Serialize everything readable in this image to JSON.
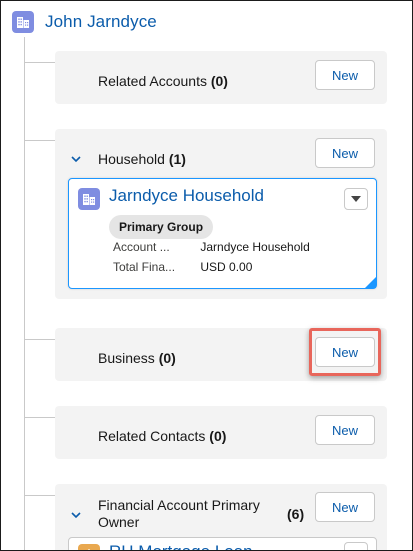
{
  "header": {
    "title": "John Jarndyce",
    "icon": "account-icon"
  },
  "groups": {
    "related_accounts": {
      "label": "Related Accounts",
      "count": "(0)",
      "new_label": "New"
    },
    "household": {
      "label": "Household",
      "count": "(1)",
      "new_label": "New",
      "record": {
        "title": "Jarndyce Household",
        "badge": "Primary Group",
        "fields": [
          {
            "label": "Account ...",
            "value": "Jarndyce Household"
          },
          {
            "label": "Total Fina...",
            "value": "USD 0.00"
          }
        ]
      }
    },
    "business": {
      "label": "Business",
      "count": "(0)",
      "new_label": "New"
    },
    "related_contacts": {
      "label": "Related Contacts",
      "count": "(0)",
      "new_label": "New"
    },
    "financial_account_primary_owner": {
      "label_line1": "Financial Account Primary",
      "label_line2": "Owner",
      "count": "(6)",
      "new_label": "New",
      "record": {
        "title": "RH Mortgage Loan"
      }
    }
  },
  "colors": {
    "link": "#0b5cab",
    "account_icon_bg": "#7f8de1",
    "financial_icon_bg": "#e9a84f",
    "group_bg": "#f3f3f3",
    "highlight": "#e8665b",
    "selected_border": "#1b96ff"
  }
}
